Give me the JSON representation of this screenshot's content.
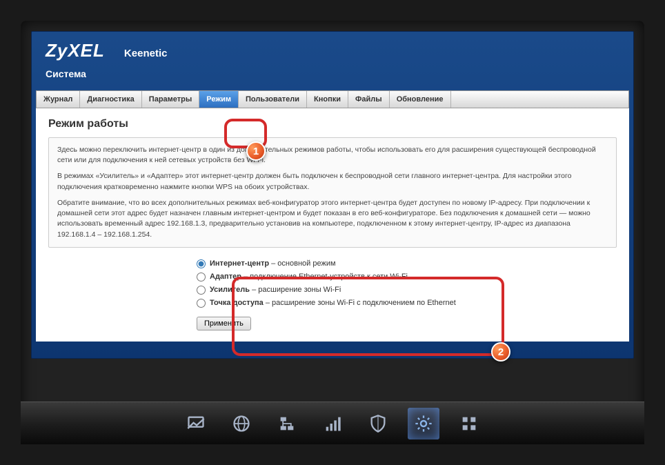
{
  "brand": "ZyXEL",
  "product": "Keenetic",
  "section": "Система",
  "tabs": [
    {
      "label": "Журнал"
    },
    {
      "label": "Диагностика"
    },
    {
      "label": "Параметры"
    },
    {
      "label": "Режим"
    },
    {
      "label": "Пользователи"
    },
    {
      "label": "Кнопки"
    },
    {
      "label": "Файлы"
    },
    {
      "label": "Обновление"
    }
  ],
  "activeTabIndex": 3,
  "pageTitle": "Режим работы",
  "info": {
    "p1": "Здесь можно переключить интернет-центр в один из дополнительных режимов работы, чтобы использовать его для расширения существующей беспроводной сети или для подключения к ней сетевых устройств без Wi-Fi.",
    "p2": "В режимах «Усилитель» и «Адаптер» этот интернет-центр должен быть подключен к беспроводной сети главного интернет-центра. Для настройки этого подключения кратковременно нажмите кнопки WPS на обоих устройствах.",
    "p3": "Обратите внимание, что во всех дополнительных режимах веб-конфигуратор этого интернет-центра будет доступен по новому IP-адресу. При подключении к домашней сети этот адрес будет назначен главным интернет-центром и будет показан в его веб-конфигураторе. Без подключения к домашней сети — можно использовать временный адрес 192.168.1.3, предварительно установив на компьютере, подключенном к этому интернет-центру, IP-адрес из диапазона 192.168.1.4 – 192.168.1.254."
  },
  "modes": [
    {
      "strong": "Интернет-центр",
      "rest": " – основной режим",
      "checked": true
    },
    {
      "strong": "Адаптер",
      "rest": " – подключение Ethernet-устройств к сети Wi-Fi",
      "checked": false
    },
    {
      "strong": "Усилитель",
      "rest": " – расширение зоны Wi-Fi",
      "checked": false
    },
    {
      "strong": "Точка доступа",
      "rest": " – расширение зоны Wi-Fi с подключением по Ethernet",
      "checked": false
    }
  ],
  "applyLabel": "Применить",
  "callouts": {
    "c1": "1",
    "c2": "2"
  },
  "dock": {
    "items": [
      "monitor",
      "globe",
      "network",
      "signal",
      "shield",
      "gear",
      "apps"
    ],
    "activeIndex": 5
  }
}
